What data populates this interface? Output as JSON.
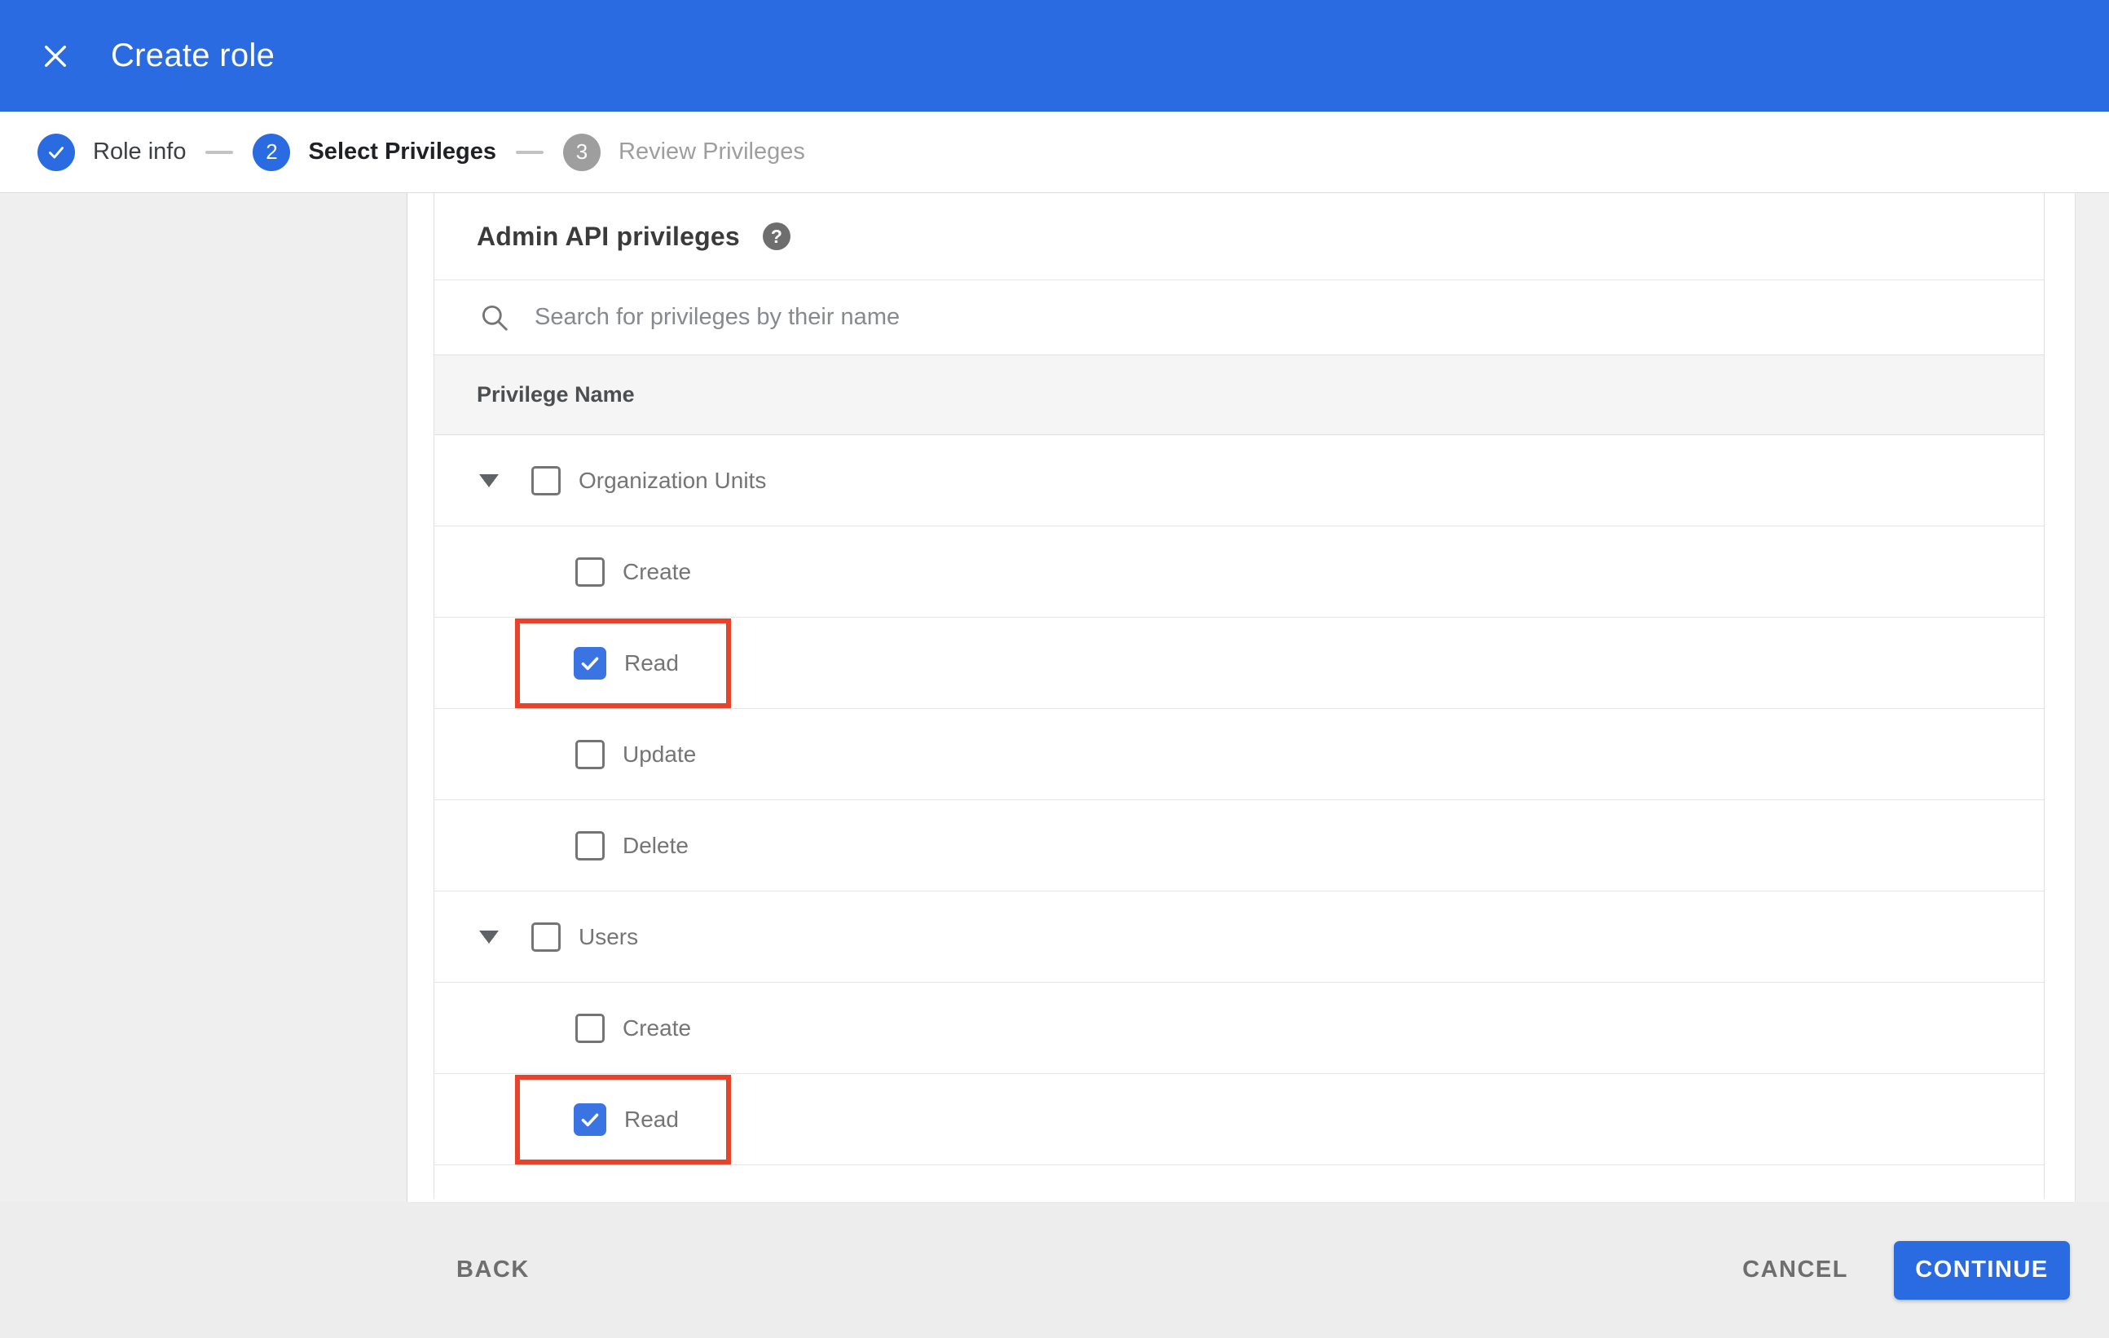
{
  "header": {
    "title": "Create role"
  },
  "stepper": {
    "steps": [
      {
        "number": "1",
        "label": "Role info",
        "state": "completed"
      },
      {
        "number": "2",
        "label": "Select Privileges",
        "state": "current"
      },
      {
        "number": "3",
        "label": "Review Privileges",
        "state": "upcoming"
      }
    ]
  },
  "content": {
    "heading": "Admin API privileges",
    "help_icon_glyph": "?",
    "search": {
      "placeholder": "Search for privileges by their name",
      "value": ""
    },
    "table": {
      "header": "Privilege Name",
      "rows": [
        {
          "label": "Organization Units",
          "type": "group",
          "checked": false,
          "highlighted": false
        },
        {
          "label": "Create",
          "type": "child",
          "checked": false,
          "highlighted": false
        },
        {
          "label": "Read",
          "type": "child",
          "checked": true,
          "highlighted": true
        },
        {
          "label": "Update",
          "type": "child",
          "checked": false,
          "highlighted": false
        },
        {
          "label": "Delete",
          "type": "child",
          "checked": false,
          "highlighted": false
        },
        {
          "label": "Users",
          "type": "group",
          "checked": false,
          "highlighted": false
        },
        {
          "label": "Create",
          "type": "child",
          "checked": false,
          "highlighted": false
        },
        {
          "label": "Read",
          "type": "child",
          "checked": true,
          "highlighted": true
        }
      ]
    }
  },
  "footer": {
    "back_label": "BACK",
    "cancel_label": "CANCEL",
    "continue_label": "CONTINUE"
  },
  "colors": {
    "header_blue": "#2b6be2",
    "checkbox_blue": "#3a73e2",
    "annotation_red": "#e8432a",
    "step_inactive_gray": "#9e9e9e",
    "footer_gray": "#ededed"
  }
}
